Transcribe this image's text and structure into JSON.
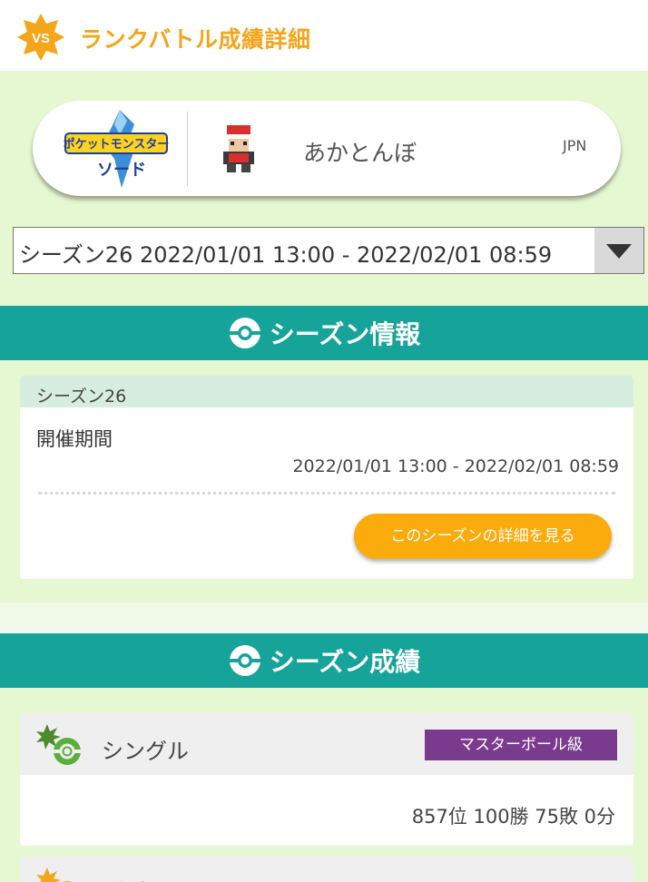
{
  "header": {
    "title": "ランクバトル成績詳細",
    "badge": "VS"
  },
  "player": {
    "game_logo": "ポケットモンスター ソード",
    "name": "あかとんぼ",
    "country": "JPN"
  },
  "season_select": {
    "value": "シーズン26 2022/01/01 13:00 - 2022/02/01 08:59"
  },
  "season_info": {
    "title": "シーズン情報",
    "season_label": "シーズン26",
    "period_label": "開催期間",
    "period_value": "2022/01/01 13:00 - 2022/02/01 08:59",
    "detail_button": "このシーズンの詳細を見る"
  },
  "season_results": {
    "title": "シーズン成績",
    "single": {
      "mode": "シングル",
      "rank": "マスターボール級",
      "record": "857位 100勝 75敗 0分"
    },
    "double": {
      "mode": "ダブル"
    }
  },
  "colors": {
    "accent_orange": "#f4a51a",
    "band_teal": "#16a39a",
    "background_green": "#e6f8d2",
    "rank_purple": "#7a3a8e",
    "button_orange": "#fbab0c"
  },
  "icons": [
    "vs-badge-icon",
    "sword-game-logo",
    "trainer-sprite-icon",
    "pokeball-icon",
    "chevron-down-icon",
    "single-battle-icon",
    "double-battle-icon"
  ]
}
